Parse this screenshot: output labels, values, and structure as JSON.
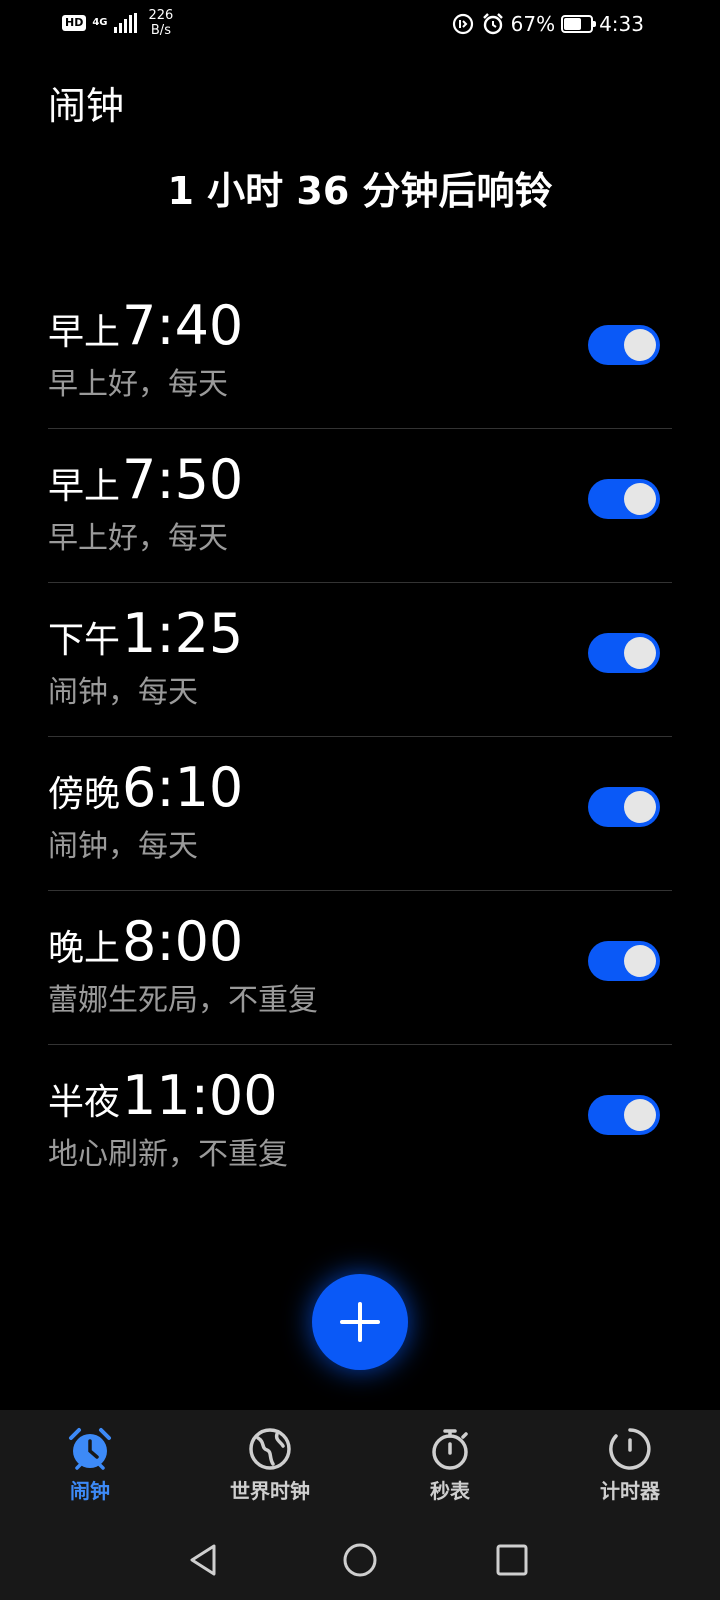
{
  "status_bar": {
    "hd": "HD",
    "net_type": "4G",
    "speed_value": "226",
    "speed_unit": "B/s",
    "battery_percent": "67%",
    "battery_level": 0.67,
    "time": "4:33",
    "icons": [
      "signal-icon",
      "data-saver-icon",
      "alarm-status-icon",
      "battery-icon"
    ]
  },
  "header": {
    "title": "闹钟",
    "next_ring": "1 小时 36 分钟后响铃"
  },
  "alarms": [
    {
      "period": "早上",
      "time": "7:40",
      "label": "早上好，每天",
      "enabled": true
    },
    {
      "period": "早上",
      "time": "7:50",
      "label": "早上好，每天",
      "enabled": true
    },
    {
      "period": "下午",
      "time": "1:25",
      "label": "闹钟，每天",
      "enabled": true
    },
    {
      "period": "傍晚",
      "time": "6:10",
      "label": "闹钟，每天",
      "enabled": true
    },
    {
      "period": "晚上",
      "time": "8:00",
      "label": "蕾娜生死局，不重复",
      "enabled": true
    },
    {
      "period": "半夜",
      "time": "11:00",
      "label": "地心刷新，不重复",
      "enabled": true
    }
  ],
  "fab": {
    "icon": "plus-icon"
  },
  "bottom_nav": {
    "items": [
      {
        "label": "闹钟",
        "icon": "alarm-clock-icon",
        "active": true
      },
      {
        "label": "世界时钟",
        "icon": "globe-icon",
        "active": false
      },
      {
        "label": "秒表",
        "icon": "stopwatch-icon",
        "active": false
      },
      {
        "label": "计时器",
        "icon": "timer-icon",
        "active": false
      }
    ]
  },
  "system_nav": {
    "icons": [
      "back-icon",
      "home-icon",
      "recents-icon"
    ]
  },
  "colors": {
    "accent": "#0a59f7",
    "active_nav": "#3d8af7",
    "background": "#000000",
    "secondary_text": "#9a9a9a",
    "nav_background": "#181818"
  }
}
